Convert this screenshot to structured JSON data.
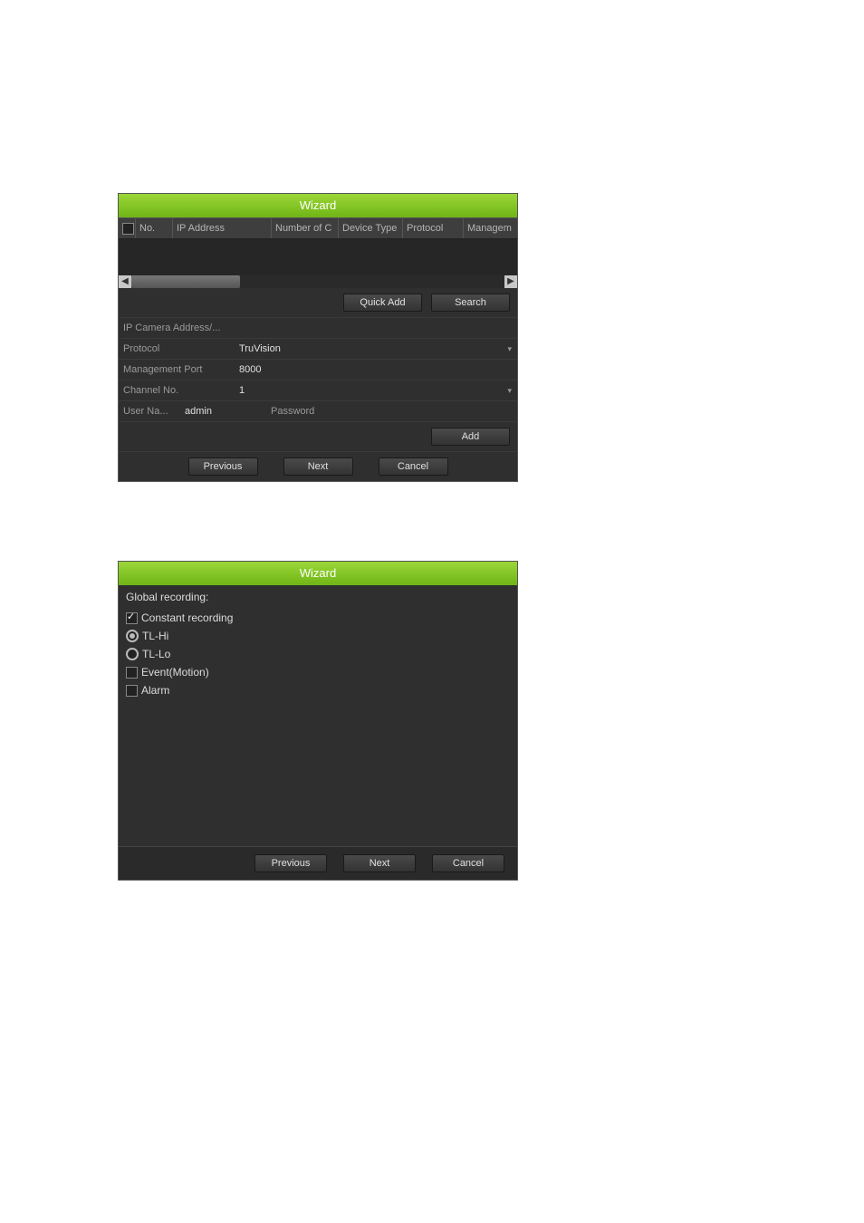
{
  "wizard1": {
    "title": "Wizard",
    "columns": [
      "No.",
      "IP Address",
      "Number of C",
      "Device Type",
      "Protocol",
      "Managem"
    ],
    "quick_add": "Quick Add",
    "search": "Search",
    "fields": {
      "ip_cam_addr_label": "IP Camera Address/...",
      "ip_cam_addr_value": "",
      "protocol_label": "Protocol",
      "protocol_value": "TruVision",
      "mgmt_port_label": "Management Port",
      "mgmt_port_value": "8000",
      "channel_no_label": "Channel No.",
      "channel_no_value": "1",
      "user_na_label": "User Na...",
      "user_na_value": "admin",
      "password_label": "Password",
      "password_value": ""
    },
    "add": "Add",
    "previous": "Previous",
    "next": "Next",
    "cancel": "Cancel"
  },
  "wizard2": {
    "title": "Wizard",
    "global_recording": "Global recording:",
    "options": [
      {
        "type": "checkbox",
        "label": "Constant recording",
        "checked": true
      },
      {
        "type": "radio",
        "label": "TL-Hi",
        "checked": true
      },
      {
        "type": "radio",
        "label": "TL-Lo",
        "checked": false
      },
      {
        "type": "checkbox",
        "label": "Event(Motion)",
        "checked": false
      },
      {
        "type": "checkbox",
        "label": "Alarm",
        "checked": false
      }
    ],
    "previous": "Previous",
    "next": "Next",
    "cancel": "Cancel"
  }
}
